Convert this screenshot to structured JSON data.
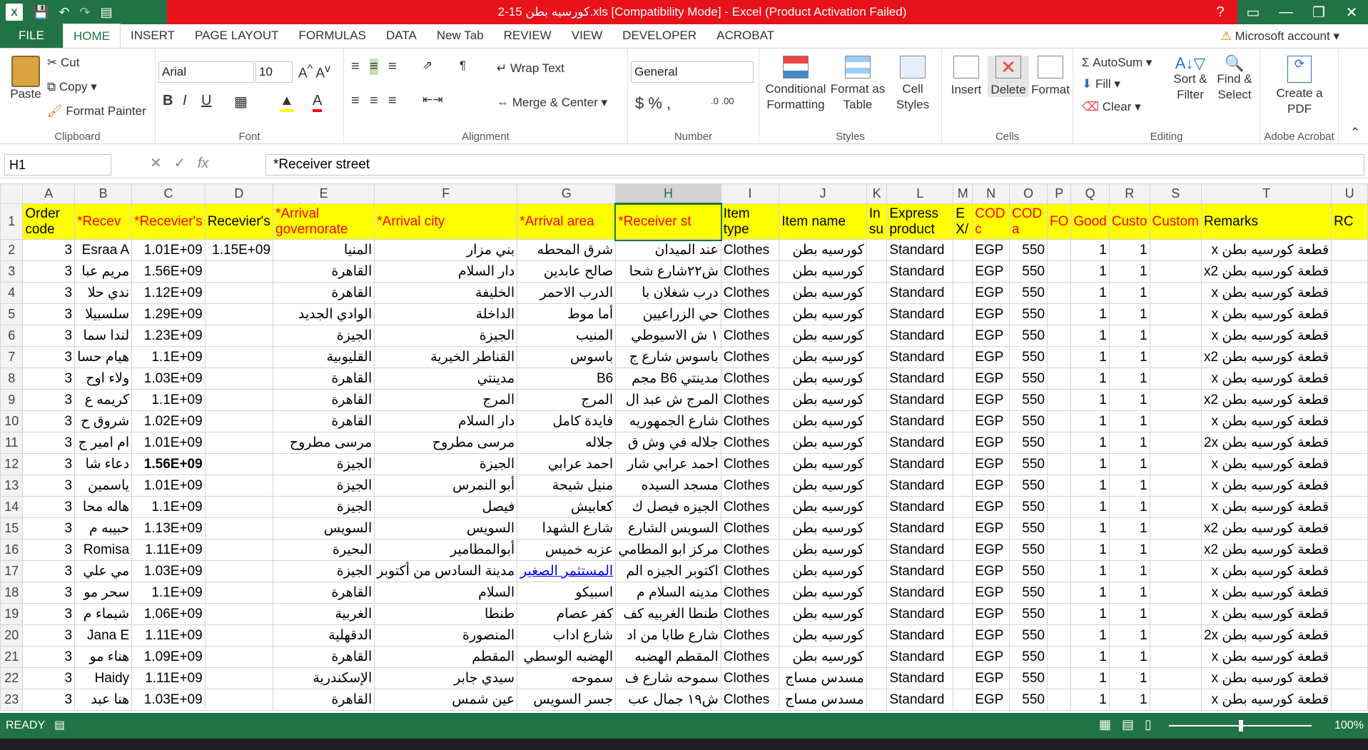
{
  "window": {
    "title": "كورسيه بطن 15-2.xls  [Compatibility Mode] -  Excel (Product Activation Failed)",
    "app_icon": "excel-icon"
  },
  "tabs": [
    "FILE",
    "HOME",
    "INSERT",
    "PAGE LAYOUT",
    "FORMULAS",
    "DATA",
    "New Tab",
    "REVIEW",
    "VIEW",
    "DEVELOPER",
    "ACROBAT"
  ],
  "account": "Microsoft account",
  "ribbon": {
    "clipboard": {
      "paste": "Paste",
      "cut": "Cut",
      "copy": "Copy",
      "format_painter": "Format Painter",
      "label": "Clipboard"
    },
    "font": {
      "name": "Arial",
      "size": "10",
      "label": "Font"
    },
    "alignment": {
      "wrap": "Wrap Text",
      "merge": "Merge & Center",
      "label": "Alignment"
    },
    "number": {
      "format": "General",
      "label": "Number"
    },
    "styles": {
      "conditional": "Conditional Formatting",
      "format_table": "Format as Table",
      "cell_styles": "Cell Styles",
      "label": "Styles"
    },
    "cells": {
      "insert": "Insert",
      "delete": "Delete",
      "format": "Format",
      "label": "Cells"
    },
    "editing": {
      "autosum": "AutoSum",
      "fill": "Fill",
      "clear": "Clear",
      "sort": "Sort & Filter",
      "find": "Find & Select",
      "label": "Editing"
    },
    "acrobat": {
      "create": "Create a PDF",
      "label": "Adobe Acrobat"
    }
  },
  "formula_bar": {
    "name_box": "H1",
    "value": "*Receiver street"
  },
  "columns": [
    "A",
    "B",
    "C",
    "D",
    "E",
    "F",
    "G",
    "H",
    "I",
    "J",
    "K",
    "L",
    "M",
    "N",
    "O",
    "P",
    "Q",
    "R",
    "S",
    "T",
    "U"
  ],
  "header_row": [
    "Order code",
    "*Recev",
    "*Recevier's",
    "Recevier's",
    "*Arrival governorate",
    "*Arrival city",
    "*Arrival area",
    "*Receiver st",
    "Item type",
    "Item name",
    "In su",
    "Express product",
    "E X/",
    "COD c",
    "COD a",
    "FO",
    "Good",
    "Custo",
    "Custom",
    "Remarks",
    "RC"
  ],
  "rows": [
    [
      "3",
      "Esraa A",
      "1.01E+09",
      "1.15E+09",
      "المنيا",
      "بني مزار",
      "شرق المحطه",
      "عند الميدان",
      "Clothes",
      "كورسيه بطن",
      "",
      "Standard",
      "",
      "EGP",
      "550",
      "",
      "1",
      "1",
      "",
      "قطعة كورسيه بطن x",
      ""
    ],
    [
      "3",
      "مريم عبا",
      "1.56E+09",
      "",
      "القاهرة",
      "دار السلام",
      "صالح عابدين",
      "ش٢٢شارع شحا",
      "Clothes",
      "كورسيه بطن",
      "",
      "Standard",
      "",
      "EGP",
      "550",
      "",
      "1",
      "1",
      "",
      "قطعة كورسيه بطن x2",
      ""
    ],
    [
      "3",
      "ندي حلا",
      "1.12E+09",
      "",
      "القاهرة",
      "الخليفة",
      "الدرب الاحمر",
      "درب شغلان با",
      "Clothes",
      "كورسيه بطن",
      "",
      "Standard",
      "",
      "EGP",
      "550",
      "",
      "1",
      "1",
      "",
      "قطعة كورسيه بطن x",
      ""
    ],
    [
      "3",
      "سلسبيلا",
      "1.29E+09",
      "",
      "الوادي الجديد",
      "الداخلة",
      "أما موط",
      "حي الزراعيين",
      "Clothes",
      "كورسيه بطن",
      "",
      "Standard",
      "",
      "EGP",
      "550",
      "",
      "1",
      "1",
      "",
      "قطعة كورسيه بطن x",
      ""
    ],
    [
      "3",
      "لندا سما",
      "1.23E+09",
      "",
      "الجيزة",
      "الجيزة",
      "المنيب",
      "١ ش الاسيوطي",
      "Clothes",
      "كورسيه بطن",
      "",
      "Standard",
      "",
      "EGP",
      "550",
      "",
      "1",
      "1",
      "",
      "قطعة كورسيه بطن x",
      ""
    ],
    [
      "3",
      "هيام حسا",
      "1.1E+09",
      "",
      "القليوبية",
      "القناطر الخيرية",
      "باسوس",
      "باسوس شارع ج",
      "Clothes",
      "كورسيه بطن",
      "",
      "Standard",
      "",
      "EGP",
      "550",
      "",
      "1",
      "1",
      "",
      "قطعة كورسيه بطن x2",
      ""
    ],
    [
      "3",
      "ولاء اوح",
      "1.03E+09",
      "",
      "القاهرة",
      "مدينتي",
      "B6",
      "مدينتي B6 مجم",
      "Clothes",
      "كورسيه بطن",
      "",
      "Standard",
      "",
      "EGP",
      "550",
      "",
      "1",
      "1",
      "",
      "قطعة كورسيه بطن x",
      ""
    ],
    [
      "3",
      "كريمه ع",
      "1.1E+09",
      "",
      "القاهرة",
      "المرج",
      "المرج",
      "المرج ش عبد ال",
      "Clothes",
      "كورسيه بطن",
      "",
      "Standard",
      "",
      "EGP",
      "550",
      "",
      "1",
      "1",
      "",
      "قطعة كورسيه بطن x2",
      ""
    ],
    [
      "3",
      "شروق ح",
      "1.02E+09",
      "",
      "القاهرة",
      "دار السلام",
      "فايدة كامل",
      "شارع الجمهوريه",
      "Clothes",
      "كورسيه بطن",
      "",
      "Standard",
      "",
      "EGP",
      "550",
      "",
      "1",
      "1",
      "",
      "قطعة كورسيه بطن x",
      ""
    ],
    [
      "3",
      "ام امير ج",
      "1.01E+09",
      "",
      "مرسى مطروح",
      "مرسى مطروح",
      "جلاله",
      "جلاله في وش ق",
      "Clothes",
      "كورسيه بطن",
      "",
      "Standard",
      "",
      "EGP",
      "550",
      "",
      "1",
      "1",
      "",
      "قطعة كورسيه بطن 2x",
      ""
    ],
    [
      "3",
      "دعاء شا",
      "1.56E+09",
      "",
      "الجيزة",
      "الجيزة",
      "احمد عرابي",
      "احمد عرابي شار",
      "Clothes",
      "كورسيه بطن",
      "",
      "Standard",
      "",
      "EGP",
      "550",
      "",
      "1",
      "1",
      "",
      "قطعة كورسيه بطن x",
      ""
    ],
    [
      "3",
      "ياسمين",
      "1.01E+09",
      "",
      "الجيزة",
      "أبو النمرس",
      "منيل شيحة",
      "مسجد السيده",
      "Clothes",
      "كورسيه بطن",
      "",
      "Standard",
      "",
      "EGP",
      "550",
      "",
      "1",
      "1",
      "",
      "قطعة كورسيه بطن x",
      ""
    ],
    [
      "3",
      "هاله محا",
      "1.1E+09",
      "",
      "الجيزة",
      "فيصل",
      "كعابيش",
      "الجيزه فيصل ك",
      "Clothes",
      "كورسيه بطن",
      "",
      "Standard",
      "",
      "EGP",
      "550",
      "",
      "1",
      "1",
      "",
      "قطعة كورسيه بطن x",
      ""
    ],
    [
      "3",
      "حبيبه م",
      "1.13E+09",
      "",
      "السويس",
      "السويس",
      "شارع الشهدا",
      "السويس الشارع",
      "Clothes",
      "كورسيه بطن",
      "",
      "Standard",
      "",
      "EGP",
      "550",
      "",
      "1",
      "1",
      "",
      "قطعة كورسيه بطن x2",
      ""
    ],
    [
      "3",
      "Romisa",
      "1.11E+09",
      "",
      "البحيرة",
      "أبوالمطامير",
      "عزبه خميس",
      "مركز ابو المطامي",
      "Clothes",
      "كورسيه بطن",
      "",
      "Standard",
      "",
      "EGP",
      "550",
      "",
      "1",
      "1",
      "",
      "قطعة كورسيه بطن x2",
      ""
    ],
    [
      "3",
      "مي علي",
      "1.03E+09",
      "",
      "الجيزة",
      "مدينة السادس من أكتوبر",
      "المستثمر الصغير",
      "اكتوبر الجيزه الم",
      "Clothes",
      "كورسيه بطن",
      "",
      "Standard",
      "",
      "EGP",
      "550",
      "",
      "1",
      "1",
      "",
      "قطعة كورسيه بطن x",
      ""
    ],
    [
      "3",
      "سحر مو",
      "1.1E+09",
      "",
      "القاهرة",
      "السلام",
      "اسبيكو",
      "مدينه السلام م",
      "Clothes",
      "كورسيه بطن",
      "",
      "Standard",
      "",
      "EGP",
      "550",
      "",
      "1",
      "1",
      "",
      "قطعة كورسيه بطن x",
      ""
    ],
    [
      "3",
      "شيماء م",
      "1.06E+09",
      "",
      "الغربية",
      "طنطا",
      "كفر عصام",
      "طنطا الغربيه كف",
      "Clothes",
      "كورسيه بطن",
      "",
      "Standard",
      "",
      "EGP",
      "550",
      "",
      "1",
      "1",
      "",
      "قطعة كورسيه بطن x",
      ""
    ],
    [
      "3",
      "Jana E",
      "1.11E+09",
      "",
      "الدقهلية",
      "المنصورة",
      "شارع اداب",
      "شارع طابا من اد",
      "Clothes",
      "كورسيه بطن",
      "",
      "Standard",
      "",
      "EGP",
      "550",
      "",
      "1",
      "1",
      "",
      "قطعة كورسيه بطن 2x",
      ""
    ],
    [
      "3",
      "هناء مو",
      "1.09E+09",
      "",
      "القاهرة",
      "المقطم",
      "الهضبه الوسطي",
      "المقطم الهضبه",
      "Clothes",
      "كورسيه بطن",
      "",
      "Standard",
      "",
      "EGP",
      "550",
      "",
      "1",
      "1",
      "",
      "قطعة كورسيه بطن x",
      ""
    ],
    [
      "3",
      "Haidy",
      "1.11E+09",
      "",
      "الإسكندرية",
      "سيدي جابر",
      "سموحه",
      "سموحه شارع ف",
      "Clothes",
      "مسدس مساج",
      "",
      "Standard",
      "",
      "EGP",
      "550",
      "",
      "1",
      "1",
      "",
      "قطعة كورسيه بطن x",
      ""
    ],
    [
      "3",
      "هنا عبد",
      "1.03E+09",
      "",
      "القاهرة",
      "عين شمس",
      "جسر السويس",
      "ش١٩ جمال عب",
      "Clothes",
      "مسدس مساج",
      "",
      "Standard",
      "",
      "EGP",
      "550",
      "",
      "1",
      "1",
      "",
      "قطعة كورسيه بطن x",
      ""
    ]
  ],
  "status": {
    "mode": "READY",
    "zoom": "100%"
  }
}
